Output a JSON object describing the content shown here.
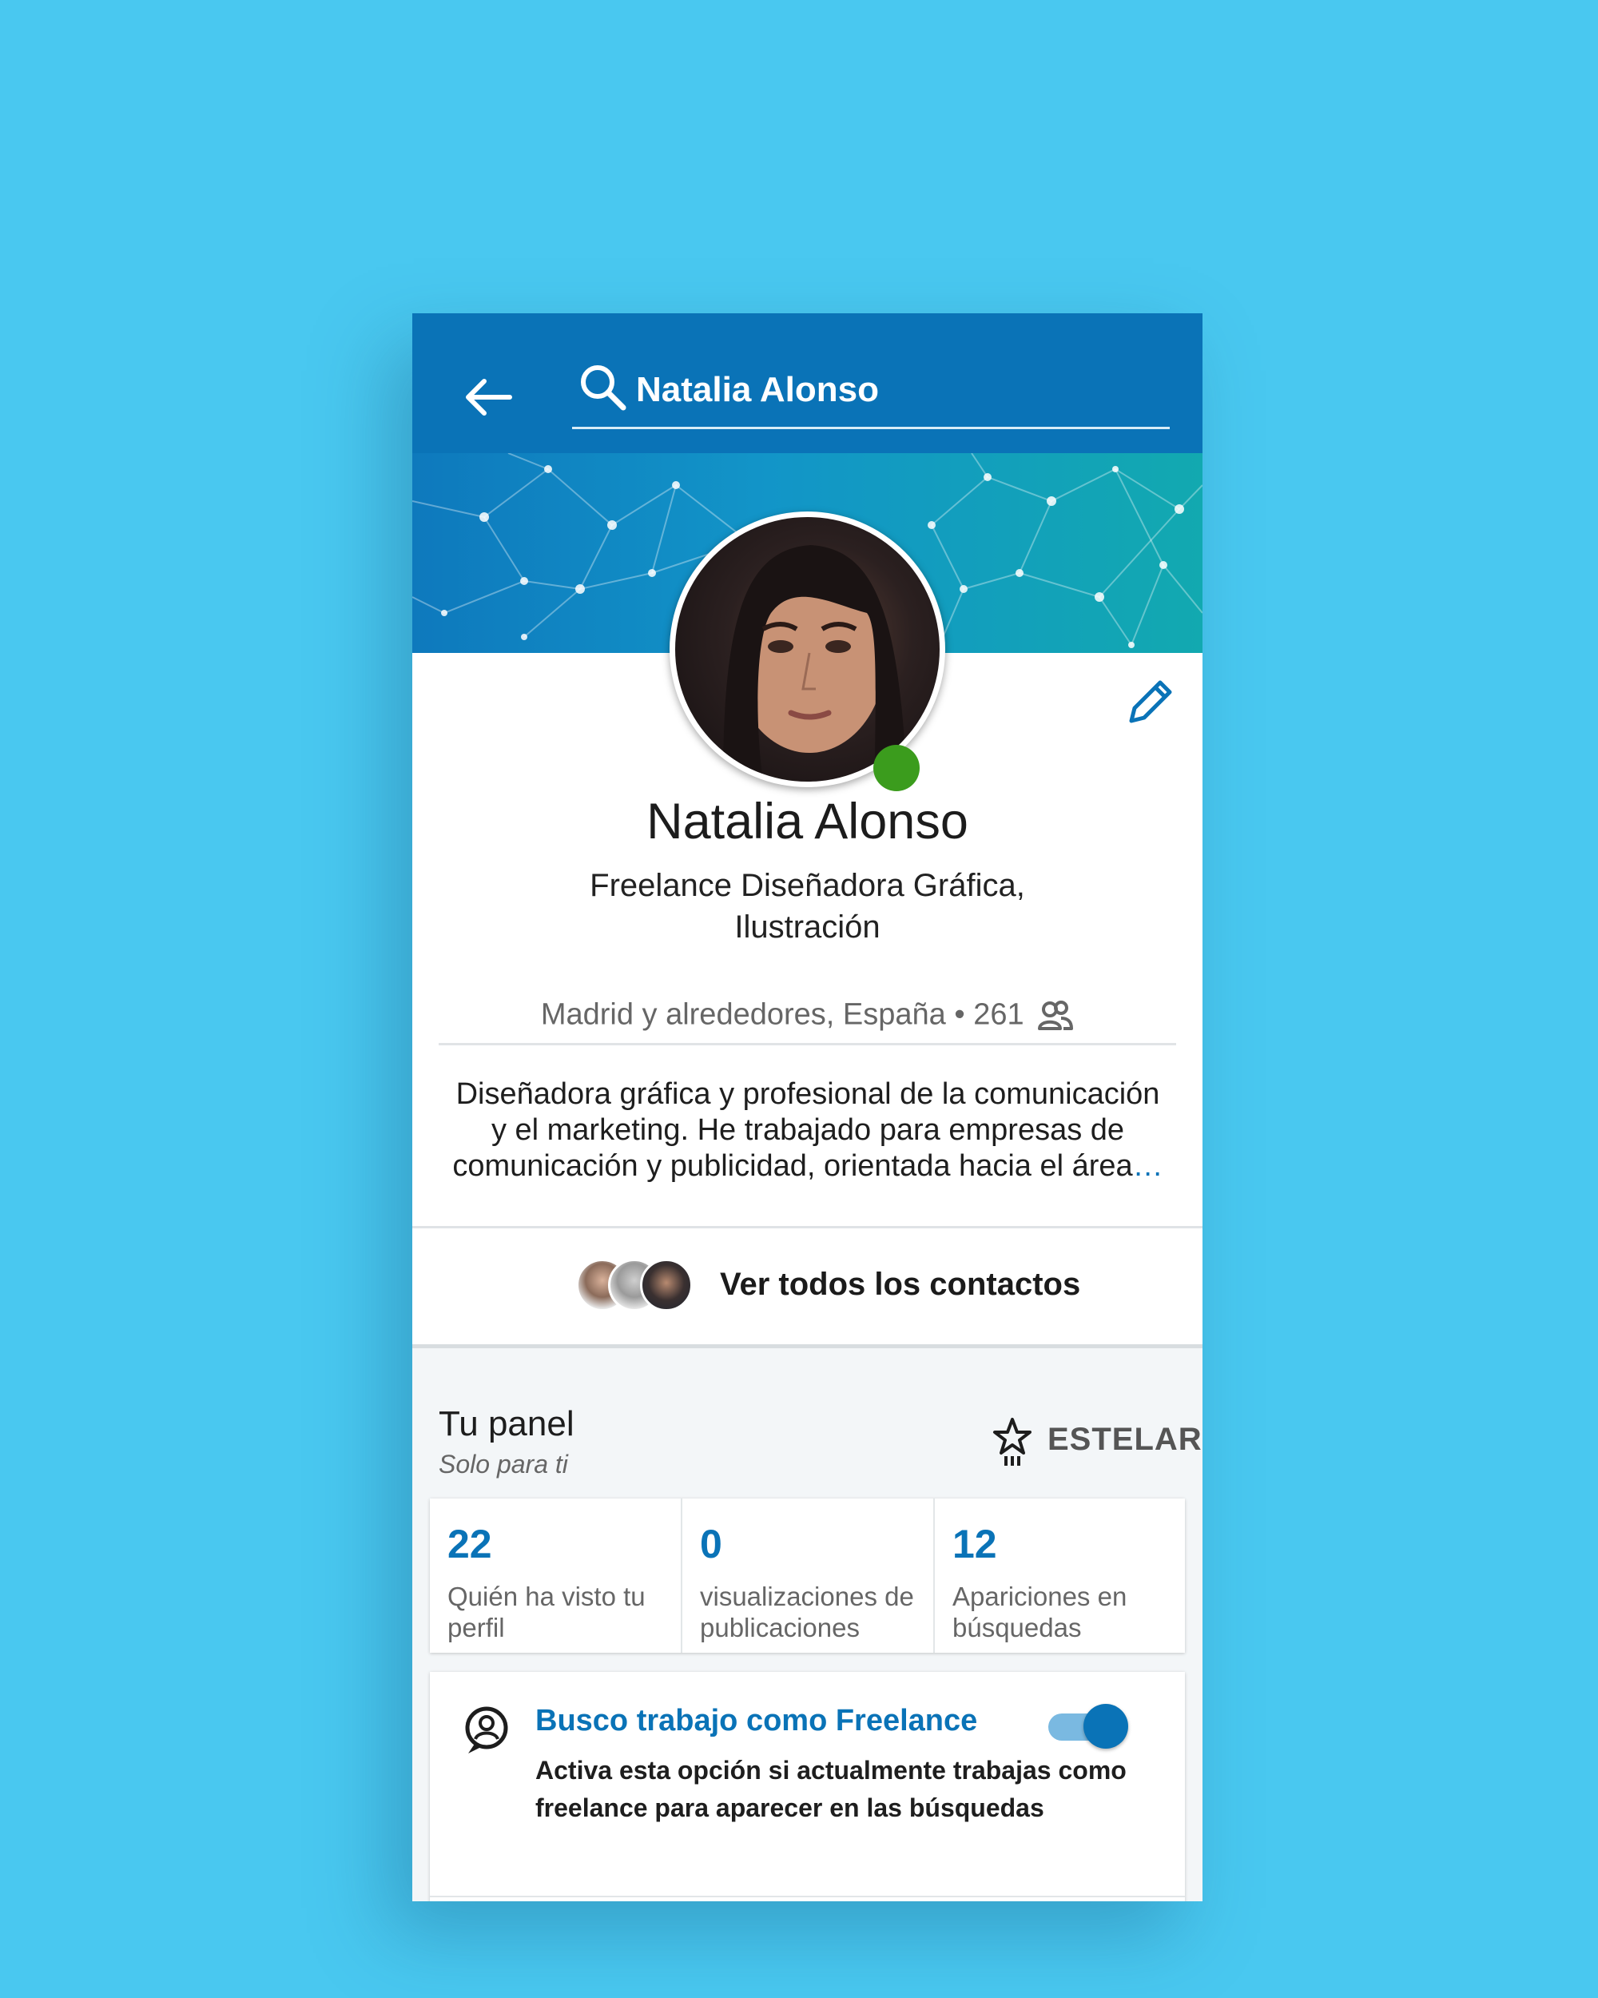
{
  "topbar": {
    "search_value": "Natalia Alonso",
    "colors": {
      "bar": "#0a73b7",
      "text": "#ffffff"
    }
  },
  "profile": {
    "name": "Natalia Alonso",
    "headline": "Freelance Diseñadora Gráfica, Ilustración",
    "location": "Madrid y alrededores, España",
    "separator": "•",
    "connections": "261",
    "summary": "Diseñadora gráfica y profesional de la comunicación y el marketing. He trabajado para empresas de comunicación y publicidad, orientada hacia el área",
    "summary_more": "…",
    "status": "online"
  },
  "contacts": {
    "label": "Ver todos los contactos"
  },
  "panel": {
    "title": "Tu panel",
    "subtitle": "Solo para ti",
    "badge_label": "ESTELAR",
    "stats": [
      {
        "value": "22",
        "label": "Quién ha visto tu perfil"
      },
      {
        "value": "0",
        "label": "visualizaciones de publicaciones"
      },
      {
        "value": "12",
        "label": "Apariciones en búsquedas"
      }
    ]
  },
  "freelance": {
    "title": "Busco trabajo como Freelance",
    "description": "Activa esta opción si actualmente trabajas como freelance para aparecer en las búsquedas",
    "toggle_on": true
  },
  "icons": [
    "back-arrow-icon",
    "search-icon",
    "edit-pencil-icon",
    "connections-icon",
    "star-icon",
    "freelance-badge-icon"
  ],
  "colors": {
    "background": "#49c8f0",
    "accent": "#0a73b7",
    "online": "#3b9c1d"
  }
}
